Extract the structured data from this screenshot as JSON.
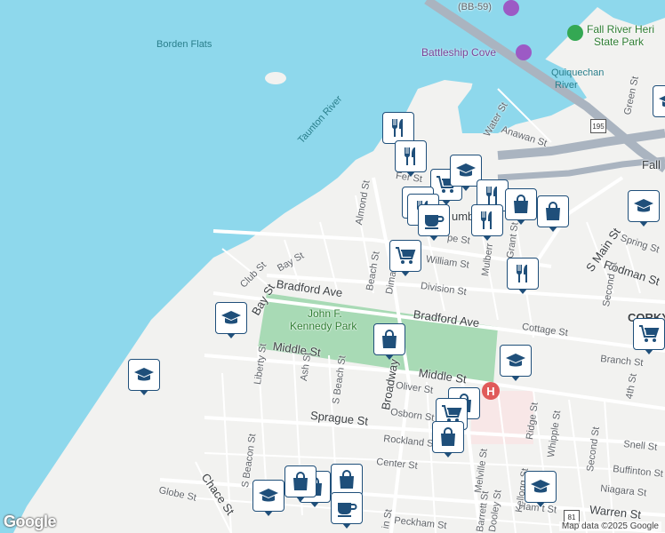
{
  "labels": {
    "borden_flats": "Borden Flats",
    "taunton_river": "Taunton River",
    "bb59": "(BB-59)",
    "battleship_cove": "Battleship Cove",
    "fall_river_heritage_1": "Fall River Heri",
    "fall_river_heritage_2": "State Park",
    "quiquechan_1": "Quiquechan",
    "quiquechan_2": "River",
    "fall": "Fall",
    "corky": "CORKY",
    "almond_st": "Almond St",
    "water_st": "Water St",
    "anawan_st": "Anawan St",
    "green_st": "Green St",
    "spring_st": "Spring St",
    "rodman_st": "Rodman St",
    "s_main_st": "S Main St",
    "second_st": "Second St",
    "club_st": "Club St",
    "bay_st": "Bay St",
    "bay_st2": "Bay St",
    "bradford_ave": "Bradford Ave",
    "bradford_ave2": "Bradford Ave",
    "beach_st": "Beach St",
    "dima": "Dima",
    "william_st": "William St",
    "division_st": "Division St",
    "cottage_st": "Cottage St",
    "branch_st": "Branch St",
    "fourth_st": "4th St",
    "jfk_park_1": "John F.",
    "jfk_park_2": "Kennedy Park",
    "middle_st": "Middle St",
    "middle_st2": "Middle St",
    "oliver_st": "Oliver St",
    "osborn_st": "Osborn St",
    "liberty_st": "Liberty St",
    "ash_st": "Ash St",
    "s_beach_st": "S Beach St",
    "broadway": "Broadway",
    "sprague_st": "Sprague St",
    "rockland_st": "Rockland St",
    "center_st": "Center St",
    "s_beacon_st": "S Beacon St",
    "chace_st": "Chace St",
    "globe_st": "Globe St",
    "peckham_st": "Peckham St",
    "melville_st": "Melville St",
    "dooley_st": "Dooley St",
    "kellogg_st": "Kellogg St",
    "barrett_st": "Barrett St",
    "ridge_st": "Ridge St",
    "whipple_st": "Whipple St",
    "second_st2": "Second St",
    "snell_st": "Snell St",
    "buffinton_st": "Buffinton St",
    "niagara_st": "Niagara St",
    "warren_st": "Warren St",
    "hamlet_st": "Ham t St",
    "mulberry": "Mulberr",
    "grant_st": "Grant St",
    "pe_st": "pe St",
    "fer_st": "Fer St",
    "umb": "umb",
    "route195": "195",
    "route81": "81",
    "h": "H",
    "in_st": "in St"
  },
  "footer": {
    "attribution": "Map data ©2025 Google",
    "logo": "Google"
  },
  "colors": {
    "water": "#8ed8ec",
    "land": "#f2f2f0",
    "park": "#a8dab5",
    "highway": "#aab4c0",
    "pin_border": "#1f4f7a"
  },
  "markers": [
    {
      "type": "restaurant"
    },
    {
      "type": "restaurant"
    },
    {
      "type": "grocery"
    },
    {
      "type": "school"
    },
    {
      "type": "restaurant"
    },
    {
      "type": "restaurant"
    },
    {
      "type": "cafe"
    },
    {
      "type": "restaurant"
    },
    {
      "type": "shopping"
    },
    {
      "type": "shopping"
    },
    {
      "type": "school"
    },
    {
      "type": "grocery"
    },
    {
      "type": "restaurant"
    },
    {
      "type": "restaurant"
    },
    {
      "type": "school"
    },
    {
      "type": "shopping"
    },
    {
      "type": "school"
    },
    {
      "type": "school"
    },
    {
      "type": "shopping"
    },
    {
      "type": "grocery"
    },
    {
      "type": "shopping"
    },
    {
      "type": "grocery"
    },
    {
      "type": "school"
    },
    {
      "type": "shopping"
    },
    {
      "type": "shopping"
    },
    {
      "type": "shopping"
    },
    {
      "type": "cafe"
    },
    {
      "type": "school"
    },
    {
      "type": "school"
    }
  ]
}
